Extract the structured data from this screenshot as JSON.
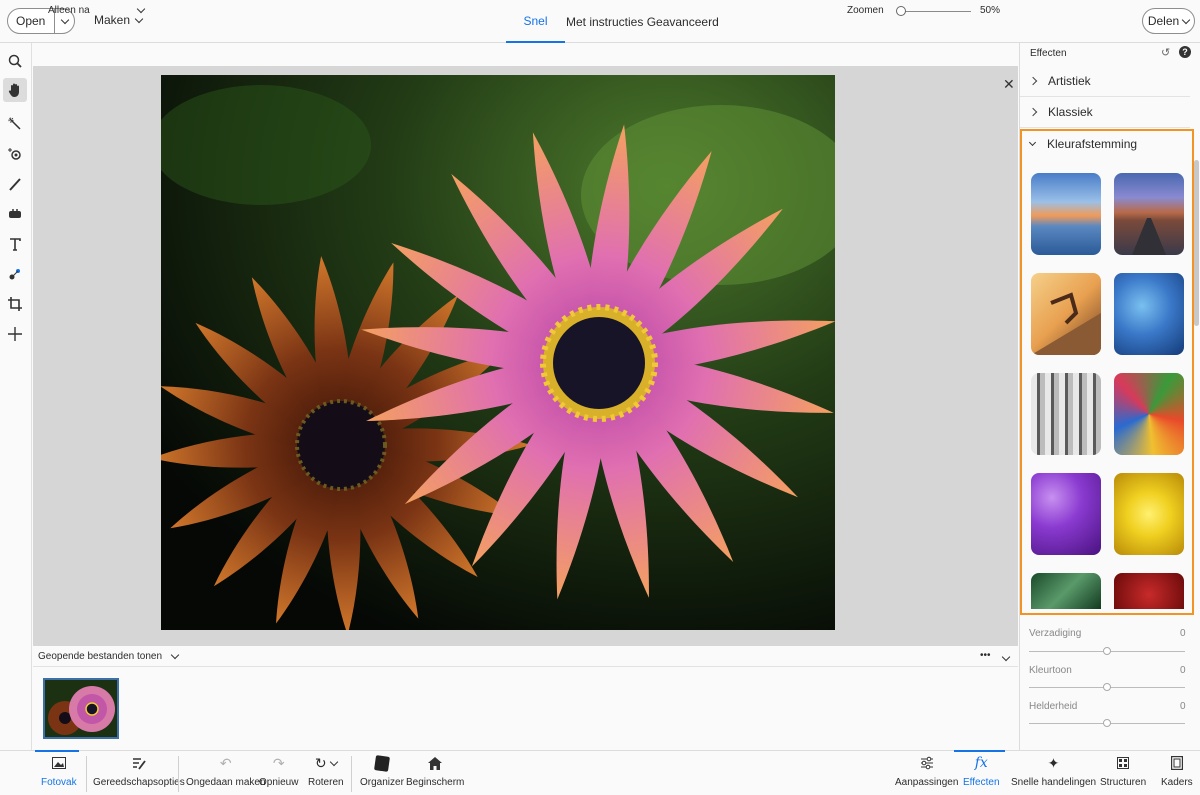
{
  "topbar": {
    "open_label": "Open",
    "make_label": "Maken",
    "tab_quick": "Snel",
    "tab_guided": "Met instructies",
    "tab_advanced": "Geavanceerd",
    "share_label": "Delen",
    "accent_color": "#1473e6"
  },
  "tools": [
    "zoom-icon",
    "hand-icon",
    "quick-selection-icon",
    "red-eye-icon",
    "whiten-teeth-icon",
    "sponge-icon",
    "type-icon",
    "spot-healing-icon",
    "crop-icon",
    "move-icon"
  ],
  "options_bar": {
    "view_select": "Alleen na",
    "zoom_label": "Zoomen",
    "zoom_value": "50%",
    "zoom_level": 0.05
  },
  "open_files": {
    "label": "Geopende bestanden tonen",
    "more": "•••"
  },
  "right_panel": {
    "title": "Effecten",
    "categories": [
      "Artistiek",
      "Klassiek",
      "Kleurafstemming"
    ],
    "highlight_color": "#f29423",
    "sliders": [
      {
        "label": "Verzadiging",
        "value": "0"
      },
      {
        "label": "Kleurtoon",
        "value": "0"
      },
      {
        "label": "Helderheid",
        "value": "0"
      }
    ]
  },
  "bottombar": {
    "photo_bin": "Fotovak",
    "tool_options": "Gereedschapsopties",
    "undo": "Ongedaan maken",
    "redo": "Opnieuw",
    "rotate": "Roteren",
    "organizer": "Organizer",
    "home": "Beginscherm",
    "adjustments": "Aanpassingen",
    "effects": "Effecten",
    "quick_actions": "Snelle handelingen",
    "textures": "Structuren",
    "frames": "Kaders"
  }
}
